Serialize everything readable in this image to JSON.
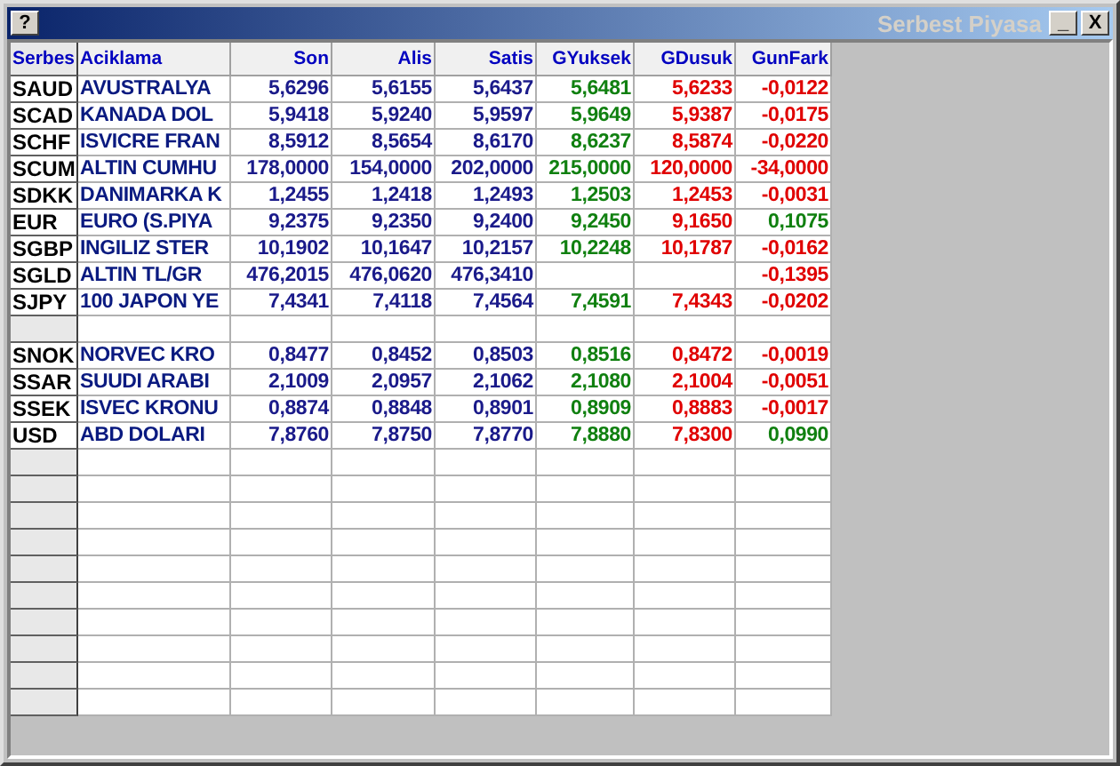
{
  "window": {
    "title": "Serbest Piyasa",
    "help_button": "?",
    "minimize_button": "_",
    "close_button": "X"
  },
  "table": {
    "columns": [
      "Serbes",
      "Aciklama",
      "Son",
      "Alis",
      "Satis",
      "GYuksek",
      "GDusuk",
      "GunFark"
    ],
    "rows": [
      {
        "kind": "data",
        "code": "SAUD",
        "name": "AVUSTRALYA",
        "son": "5,6296",
        "alis": "5,6155",
        "satis": "5,6437",
        "gyuksek": "5,6481",
        "gdusuk": "5,6233",
        "gunfark": "-0,0122",
        "color": "#e00000"
      },
      {
        "kind": "data",
        "code": "SCAD",
        "name": "KANADA DOL",
        "son": "5,9418",
        "alis": "5,9240",
        "satis": "5,9597",
        "gyuksek": "5,9649",
        "gdusuk": "5,9387",
        "gunfark": "-0,0175",
        "color": "#e00000"
      },
      {
        "kind": "data",
        "code": "SCHF",
        "name": "ISVICRE FRAN",
        "son": "8,5912",
        "alis": "8,5654",
        "satis": "8,6170",
        "gyuksek": "8,6237",
        "gdusuk": "8,5874",
        "gunfark": "-0,0220",
        "color": "#e00000"
      },
      {
        "kind": "data",
        "code": "SCUM",
        "name": "ALTIN CUMHU",
        "son": "178,0000",
        "alis": "154,0000",
        "satis": "202,0000",
        "gyuksek": "215,0000",
        "gdusuk": "120,0000",
        "gunfark": "-34,0000",
        "color": "#e00000"
      },
      {
        "kind": "data",
        "code": "SDKK",
        "name": "DANIMARKA K",
        "son": "1,2455",
        "alis": "1,2418",
        "satis": "1,2493",
        "gyuksek": "1,2503",
        "gdusuk": "1,2453",
        "gunfark": "-0,0031",
        "color": "#e00000"
      },
      {
        "kind": "data",
        "code": "EUR",
        "name": "EURO (S.PIYA",
        "son": "9,2375",
        "alis": "9,2350",
        "satis": "9,2400",
        "gyuksek": "9,2450",
        "gdusuk": "9,1650",
        "gunfark": "0,1075",
        "color": "#108010"
      },
      {
        "kind": "data",
        "code": "SGBP",
        "name": "INGILIZ STER",
        "son": "10,1902",
        "alis": "10,1647",
        "satis": "10,2157",
        "gyuksek": "10,2248",
        "gdusuk": "10,1787",
        "gunfark": "-0,0162",
        "color": "#e00000"
      },
      {
        "kind": "data",
        "code": "SGLD",
        "name": "ALTIN TL/GR",
        "son": "476,2015",
        "alis": "476,0620",
        "satis": "476,3410",
        "gunfark": "-0,1395",
        "color": "#e00000"
      },
      {
        "kind": "data",
        "code": "SJPY",
        "name": "100 JAPON YE",
        "son": "7,4341",
        "alis": "7,4118",
        "satis": "7,4564",
        "gyuksek": "7,4591",
        "gdusuk": "7,4343",
        "gunfark": "-0,0202",
        "color": "#e00000"
      },
      {
        "kind": "empty"
      },
      {
        "kind": "data",
        "code": "SNOK",
        "name": "NORVEC KRO",
        "son": "0,8477",
        "alis": "0,8452",
        "satis": "0,8503",
        "gyuksek": "0,8516",
        "gdusuk": "0,8472",
        "gunfark": "-0,0019",
        "color": "#e00000"
      },
      {
        "kind": "data",
        "code": "SSAR",
        "name": "SUUDI ARABI",
        "son": "2,1009",
        "alis": "2,0957",
        "satis": "2,1062",
        "gyuksek": "2,1080",
        "gdusuk": "2,1004",
        "gunfark": "-0,0051",
        "color": "#e00000"
      },
      {
        "kind": "data",
        "code": "SSEK",
        "name": "ISVEC KRONU",
        "son": "0,8874",
        "alis": "0,8848",
        "satis": "0,8901",
        "gyuksek": "0,8909",
        "gdusuk": "0,8883",
        "gunfark": "-0,0017",
        "color": "#e00000"
      },
      {
        "kind": "data",
        "code": "USD",
        "name": "ABD DOLARI",
        "son": "7,8760",
        "alis": "7,8750",
        "satis": "7,8770",
        "gyuksek": "7,8880",
        "gdusuk": "7,8300",
        "gunfark": "0,0990",
        "color": "#108010"
      }
    ]
  }
}
